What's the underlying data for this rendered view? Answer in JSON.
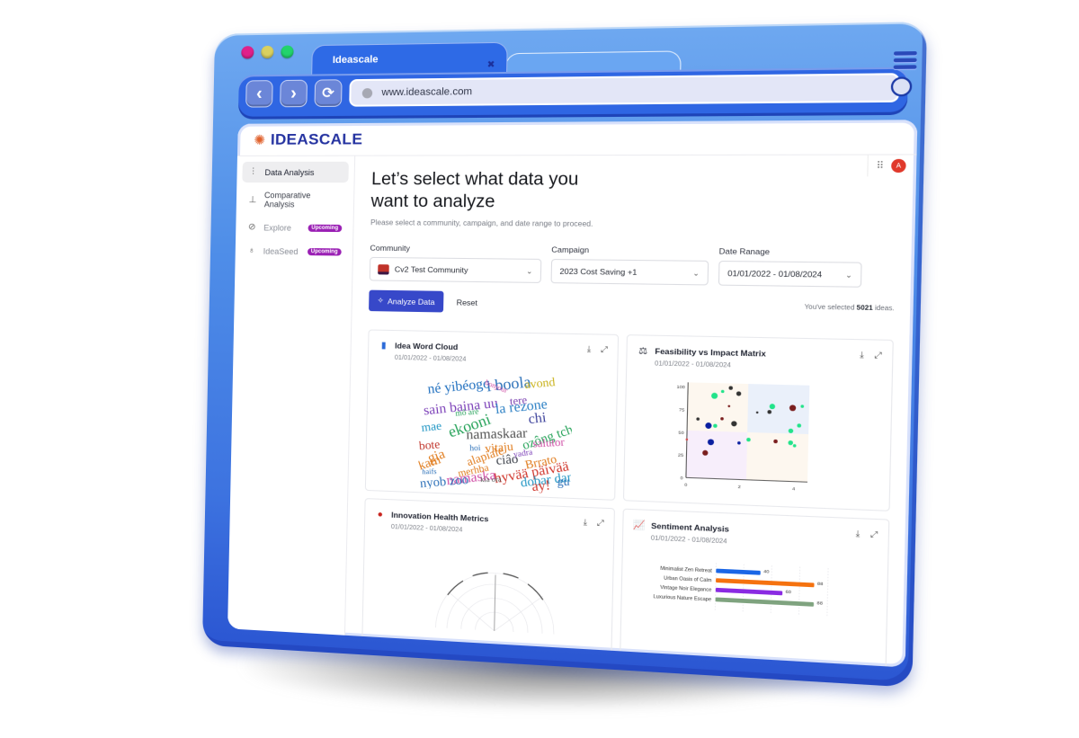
{
  "browser": {
    "tabs": [
      {
        "label": "Ideascale",
        "active": true
      },
      {
        "label": "",
        "active": false
      }
    ],
    "url": "www.ideascale.com",
    "traffic_colors": [
      "#e0208a",
      "#d9d060",
      "#22d36c"
    ]
  },
  "app": {
    "logo": "IDEASCALE",
    "avatar_initial": "A"
  },
  "sidebar": {
    "items": [
      {
        "label": "Data Analysis",
        "icon": "data-analysis-icon",
        "active": true,
        "badge": ""
      },
      {
        "label": "Comparative Analysis",
        "icon": "comparative-analysis-icon",
        "active": false,
        "badge": ""
      },
      {
        "label": "Explore",
        "icon": "compass-icon",
        "active": false,
        "badge": "Upcoming"
      },
      {
        "label": "IdeaSeed",
        "icon": "lightbulb-icon",
        "active": false,
        "badge": "Upcoming"
      }
    ]
  },
  "main": {
    "title": "Let’s select what data you want to analyze",
    "subtitle": "Please select a community, campaign, and date range to proceed.",
    "community": {
      "label": "Community",
      "value": "Cv2 Test Community"
    },
    "campaign": {
      "label": "Campaign",
      "value": "2023 Cost Saving  +1"
    },
    "date_range": {
      "label": "Date Ranage",
      "value": "01/01/2022 - 01/08/2024"
    },
    "analyze_label": "Analyze Data",
    "reset_label": "Reset",
    "selected_prefix": "You've selected ",
    "selected_count": "5021",
    "selected_suffix": " ideas."
  },
  "cards": [
    {
      "title": "Idea Word Cloud",
      "date": "01/01/2022 - 01/08/2024"
    },
    {
      "title": "Feasibility vs Impact Matrix",
      "date": "01/01/2022 - 01/08/2024"
    },
    {
      "title": "Innovation Health Metrics",
      "date": "01/01/2022 - 01/08/2024"
    },
    {
      "title": "Sentiment Analysis",
      "date": "01/01/2022 - 01/08/2024"
    }
  ],
  "wordcloud": {
    "words": [
      {
        "t": "né yibéogo",
        "c": "#1f6fbf",
        "s": 15,
        "r": -20
      },
      {
        "t": "i boola",
        "c": "#2a6fb8",
        "s": 17,
        "r": -22
      },
      {
        "t": "avond",
        "c": "#c9b21c",
        "s": 13,
        "r": -20
      },
      {
        "t": "tere",
        "c": "#7a3fb0",
        "s": 12,
        "r": -20
      },
      {
        "t": "sain baina uu",
        "c": "#7b3fb8",
        "s": 15,
        "r": -22
      },
      {
        "t": "la rezone",
        "c": "#2a7fc4",
        "s": 15,
        "r": -22
      },
      {
        "t": "chi",
        "c": "#3a3f9a",
        "s": 15,
        "r": -22
      },
      {
        "t": "mae",
        "c": "#2196c4",
        "s": 13,
        "r": -22
      },
      {
        "t": "ekooni",
        "c": "#27a35a",
        "s": 17,
        "r": -60
      },
      {
        "t": "namaskaar",
        "c": "#555555",
        "s": 15,
        "r": -10
      },
      {
        "t": "ozông tchi",
        "c": "#27a35a",
        "s": 14,
        "r": -60
      },
      {
        "t": "salutor",
        "c": "#d04ea6",
        "s": 12,
        "r": -15
      },
      {
        "t": "bote",
        "c": "#c0352b",
        "s": 13,
        "r": -20
      },
      {
        "t": "vitaju",
        "c": "#e07b1c",
        "s": 13,
        "r": -20
      },
      {
        "t": "gia",
        "c": "#e07b1c",
        "s": 15,
        "r": -60
      },
      {
        "t": "alapiale",
        "c": "#e07b1c",
        "s": 13,
        "r": -60
      },
      {
        "t": "ciâo",
        "c": "#3a3f48",
        "s": 14,
        "r": -20
      },
      {
        "t": "hyvää päivää",
        "c": "#d0352b",
        "s": 15,
        "r": -35
      },
      {
        "t": "Brrato",
        "c": "#e07b1c",
        "s": 13,
        "r": -40
      },
      {
        "t": "dobar dan",
        "c": "#2196c4",
        "s": 14,
        "r": -25
      },
      {
        "t": "namaska",
        "c": "#d04ea6",
        "s": 15,
        "r": -25
      },
      {
        "t": "nyob zoo",
        "c": "#2a6fb8",
        "s": 14,
        "r": -20
      },
      {
        "t": "ay!",
        "c": "#d0352b",
        "s": 15,
        "r": -20
      },
      {
        "t": "merhba",
        "c": "#e07b1c",
        "s": 11,
        "r": -40
      },
      {
        "t": "gu",
        "c": "#2a6fb8",
        "s": 13,
        "r": -10
      },
      {
        "t": "kam",
        "c": "#e07b1c",
        "s": 14,
        "r": -60
      },
      {
        "t": "mô aré",
        "c": "#27a35a",
        "s": 9,
        "r": -20
      },
      {
        "t": "hoi",
        "c": "#2a6fb8",
        "s": 9,
        "r": -10
      },
      {
        "t": "yadra",
        "c": "#7b3fb8",
        "s": 9,
        "r": -30
      },
      {
        "t": "haifs",
        "c": "#2a6fb8",
        "s": 8,
        "r": -10
      },
      {
        "t": "kia ora",
        "c": "#555555",
        "s": 8,
        "r": -10
      },
      {
        "t": "bonjour",
        "c": "#d04ea6",
        "s": 8,
        "r": 60
      }
    ]
  },
  "chart_data": [
    {
      "type": "scatter",
      "title": "Feasibility vs Impact Matrix",
      "xlabel": "",
      "ylabel": "",
      "xlim": [
        0,
        4.5
      ],
      "ylim": [
        0,
        105
      ],
      "x_ticks": [
        "0",
        "2",
        "4"
      ],
      "y_ticks": [
        "0",
        "25",
        "50",
        "75",
        "100"
      ],
      "quadrants": [
        {
          "name": "top-left",
          "color": "#fdf7ef"
        },
        {
          "name": "top-right",
          "color": "#eaf0fa"
        },
        {
          "name": "bottom-left",
          "color": "#f7eefb"
        },
        {
          "name": "bottom-right",
          "color": "#fdf7ef"
        }
      ],
      "points": [
        {
          "x": 0.4,
          "y": 65,
          "r": 2,
          "color": "#333333"
        },
        {
          "x": 0.8,
          "y": 58,
          "r": 4,
          "color": "#0a1fa0"
        },
        {
          "x": 0.9,
          "y": 40,
          "r": 4,
          "color": "#0a1fa0"
        },
        {
          "x": 0.7,
          "y": 28,
          "r": 3.5,
          "color": "#7a1e1e"
        },
        {
          "x": 1.0,
          "y": 91,
          "r": 4,
          "color": "#22e38a"
        },
        {
          "x": 1.05,
          "y": 58,
          "r": 2.5,
          "color": "#22e38a"
        },
        {
          "x": 1.3,
          "y": 96,
          "r": 2,
          "color": "#22e38a"
        },
        {
          "x": 1.3,
          "y": 66,
          "r": 2,
          "color": "#7a1e1e"
        },
        {
          "x": 1.55,
          "y": 80,
          "r": 1.5,
          "color": "#7a1e1e"
        },
        {
          "x": 1.6,
          "y": 100,
          "r": 2.5,
          "color": "#333333"
        },
        {
          "x": 1.75,
          "y": 61,
          "r": 3.5,
          "color": "#333333"
        },
        {
          "x": 1.9,
          "y": 94,
          "r": 3,
          "color": "#333333"
        },
        {
          "x": 1.95,
          "y": 40,
          "r": 2,
          "color": "#0a1fa0"
        },
        {
          "x": 2.3,
          "y": 44,
          "r": 2.5,
          "color": "#22e38a"
        },
        {
          "x": 2.6,
          "y": 74,
          "r": 1.5,
          "color": "#333333"
        },
        {
          "x": 3.05,
          "y": 75,
          "r": 2.5,
          "color": "#333333"
        },
        {
          "x": 3.15,
          "y": 81,
          "r": 3.5,
          "color": "#22e38a"
        },
        {
          "x": 3.3,
          "y": 43,
          "r": 2.5,
          "color": "#7a1e1e"
        },
        {
          "x": 3.85,
          "y": 55,
          "r": 3,
          "color": "#22e38a"
        },
        {
          "x": 3.85,
          "y": 42,
          "r": 3,
          "color": "#22e38a"
        },
        {
          "x": 3.9,
          "y": 80,
          "r": 4,
          "color": "#7a1e1e"
        },
        {
          "x": 4.0,
          "y": 39,
          "r": 2,
          "color": "#22e38a"
        },
        {
          "x": 4.15,
          "y": 61,
          "r": 2.5,
          "color": "#22e38a"
        },
        {
          "x": 4.25,
          "y": 82,
          "r": 2,
          "color": "#22e38a"
        },
        {
          "x": 0.0,
          "y": 42,
          "r": 1.5,
          "color": "#d04e4e"
        }
      ]
    },
    {
      "type": "bar",
      "orientation": "horizontal",
      "title": "Sentiment Analysis",
      "categories": [
        "Minimalist Zen Retreat",
        "Urban Oasis of Calm",
        "Vintage Noir Elegance",
        "Luxurious Nature Escape"
      ],
      "values": [
        40,
        88,
        60,
        88
      ],
      "colors": [
        "#1a66e6",
        "#f5720f",
        "#8a2be2",
        "#7fa37f"
      ],
      "xlim": [
        0,
        100
      ]
    },
    {
      "type": "radar",
      "title": "Innovation Health Metrics",
      "note": "partially visible polar chart"
    }
  ]
}
